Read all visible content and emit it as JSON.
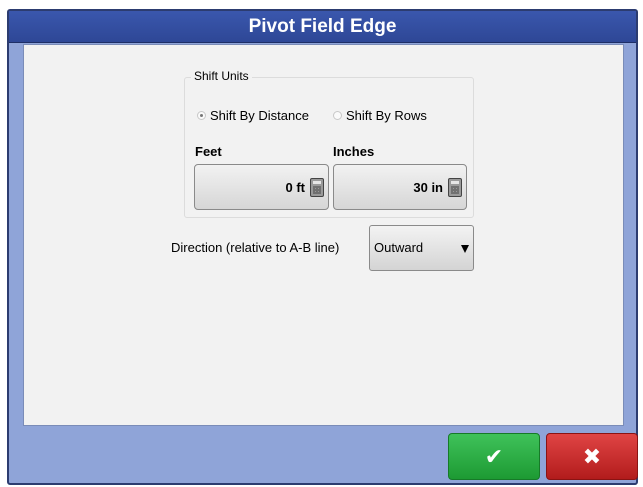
{
  "dialog": {
    "title": "Pivot Field Edge"
  },
  "shift_units": {
    "title": "Shift Units",
    "options": [
      {
        "label": "Shift By Distance",
        "selected": true
      },
      {
        "label": "Shift By Rows",
        "selected": false
      }
    ],
    "feet": {
      "label": "Feet",
      "value": "0 ft",
      "icon": "calculator-icon"
    },
    "inches": {
      "label": "Inches",
      "value": "30 in",
      "icon": "calculator-icon"
    }
  },
  "direction": {
    "label": "Direction (relative to A-B line)",
    "value": "Outward"
  },
  "buttons": {
    "ok_icon": "✔",
    "cancel_icon": "✖"
  }
}
